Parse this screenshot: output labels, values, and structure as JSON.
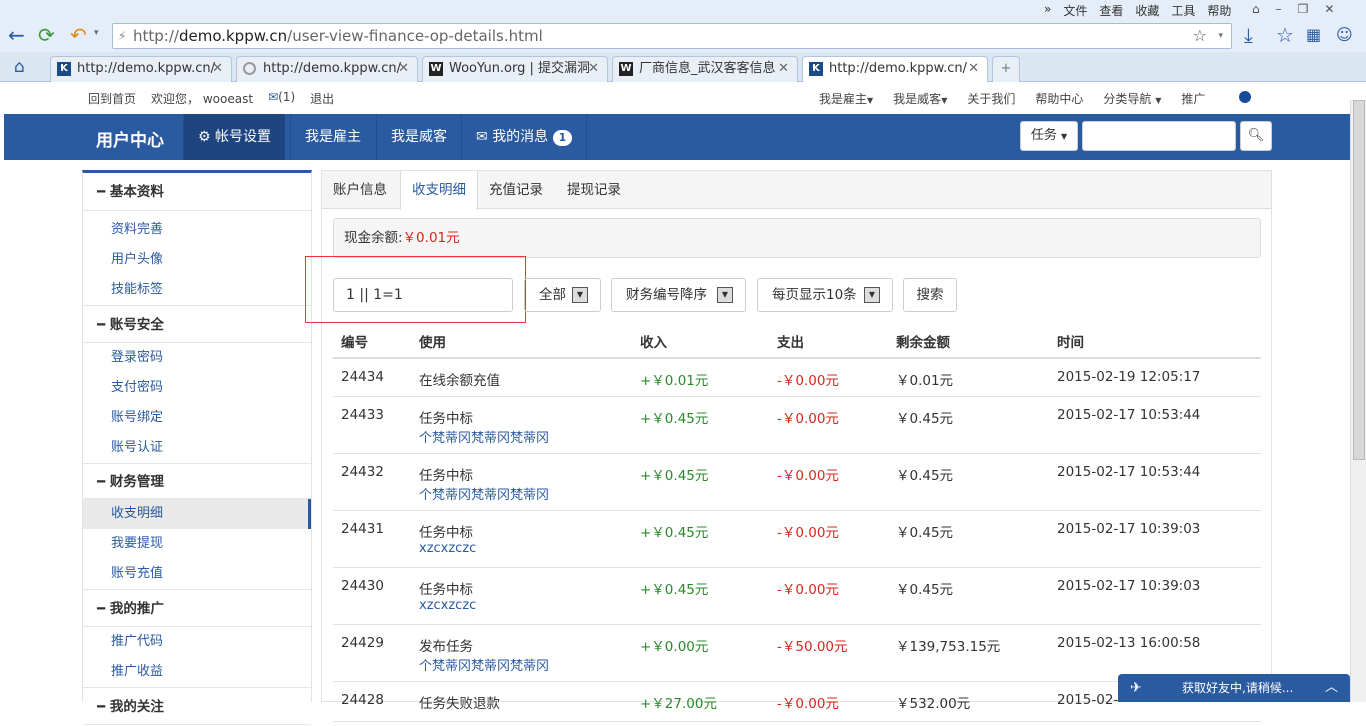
{
  "browser": {
    "menu": [
      "文件",
      "查看",
      "收藏",
      "工具",
      "帮助"
    ],
    "url_host": "demo.kppw.cn",
    "url_prefix": "http://",
    "url_path": "/user-view-finance-op-details.html",
    "tabs": [
      {
        "label": "http://demo.kppw.cn/",
        "active": false
      },
      {
        "label": "http://demo.kppw.cn/",
        "active": false
      },
      {
        "label": "WooYun.org | 提交漏洞",
        "active": false
      },
      {
        "label": "厂商信息_武汉客客信息",
        "active": false
      },
      {
        "label": "http://demo.kppw.cn/",
        "active": true
      }
    ],
    "new_tab": "+"
  },
  "topnav": {
    "home": "回到首页",
    "welcome": "欢迎您，",
    "user": "wooeast",
    "mail_count": "(1)",
    "logout": "退出",
    "right": [
      "我是雇主",
      "我是威客",
      "关于我们",
      "帮助中心",
      "分类导航",
      "推广"
    ]
  },
  "header": {
    "brand": "用户中心",
    "nav": [
      {
        "label": "帐号设置",
        "active": true
      },
      {
        "label": "我是雇主",
        "active": false
      },
      {
        "label": "我是威客",
        "active": false
      },
      {
        "label": "我的消息",
        "active": false
      }
    ],
    "msg_badge": "1",
    "search_select": "任务"
  },
  "sidebar": {
    "sections": [
      {
        "title": "基本资料",
        "items": [
          "资料完善",
          "用户头像",
          "技能标签"
        ]
      },
      {
        "title": "账号安全",
        "items": [
          "登录密码",
          "支付密码",
          "账号绑定",
          "账号认证"
        ]
      },
      {
        "title": "财务管理",
        "items": [
          "收支明细",
          "我要提现",
          "账号充值"
        ]
      },
      {
        "title": "我的推广",
        "items": [
          "推广代码",
          "推广收益"
        ]
      },
      {
        "title": "我的关注",
        "items": []
      }
    ],
    "active_item": "收支明细"
  },
  "main": {
    "tabs": [
      "账户信息",
      "收支明细",
      "充值记录",
      "提现记录"
    ],
    "active_tab": "收支明细",
    "balance_label": "现金余额:",
    "balance_value": "￥0.01元",
    "filter_value": "1 || 1=1",
    "select_type": "全部",
    "select_order": "财务编号降序",
    "select_pagesize": "每页显示10条",
    "search_button": "搜索",
    "columns": [
      "编号",
      "使用",
      "收入",
      "支出",
      "剩余金额",
      "时间"
    ],
    "rows": [
      {
        "id": "24434",
        "use": "在线余额充值",
        "sub": "",
        "in": "+￥0.01元",
        "out": "-￥0.00元",
        "remain": "￥0.01元",
        "time": "2015-02-19 12:05:17"
      },
      {
        "id": "24433",
        "use": "任务中标",
        "sub": "个梵蒂冈梵蒂冈梵蒂冈",
        "in": "+￥0.45元",
        "out": "-￥0.00元",
        "remain": "￥0.45元",
        "time": "2015-02-17 10:53:44"
      },
      {
        "id": "24432",
        "use": "任务中标",
        "sub": "个梵蒂冈梵蒂冈梵蒂冈",
        "in": "+￥0.45元",
        "out": "-￥0.00元",
        "remain": "￥0.45元",
        "time": "2015-02-17 10:53:44"
      },
      {
        "id": "24431",
        "use": "任务中标",
        "sub": "xzcxzczc",
        "in": "+￥0.45元",
        "out": "-￥0.00元",
        "remain": "￥0.45元",
        "time": "2015-02-17 10:39:03"
      },
      {
        "id": "24430",
        "use": "任务中标",
        "sub": "xzcxzczc",
        "in": "+￥0.45元",
        "out": "-￥0.00元",
        "remain": "￥0.45元",
        "time": "2015-02-17 10:39:03"
      },
      {
        "id": "24429",
        "use": "发布任务",
        "sub": "个梵蒂冈梵蒂冈梵蒂冈",
        "in": "+￥0.00元",
        "out": "-￥50.00元",
        "remain": "￥139,753.15元",
        "time": "2015-02-13 16:00:58"
      },
      {
        "id": "24428",
        "use": "任务失败退款",
        "sub": "",
        "in": "+￥27.00元",
        "out": "-￥0.00元",
        "remain": "￥532.00元",
        "time": "2015-02-"
      }
    ]
  },
  "chat": {
    "label": "获取好友中,请稍候..."
  },
  "colors": {
    "brand_blue": "#2a5aa0",
    "income_green": "#2a8a2a",
    "expense_red": "#d9261c",
    "highlight_red": "#e33"
  }
}
